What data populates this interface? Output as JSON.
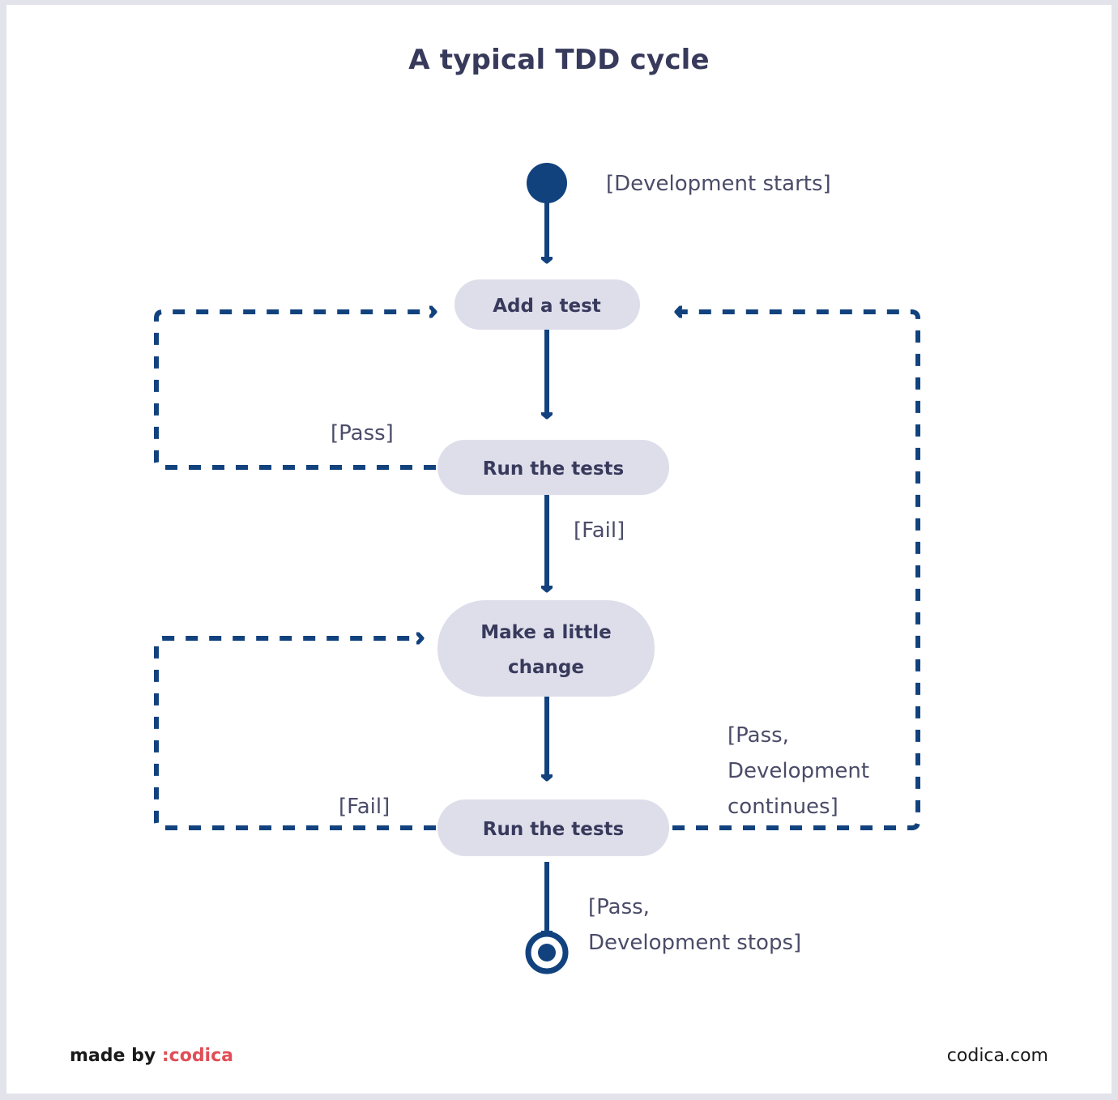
{
  "page": {
    "title": "A typical TDD cycle",
    "background_color": "#ffffff",
    "border_color": "#e3e3ec"
  },
  "colors": {
    "title_text": "#383a5c",
    "node_fill": "#dedeeb",
    "node_text": "#383a5c",
    "arrow": "#12427e",
    "guard_text": "#4a4c68",
    "brand_accent": "#e14d56"
  },
  "diagram": {
    "type": "uml-activity-diagram",
    "nodes": [
      {
        "id": "start",
        "kind": "initial-node",
        "label": ""
      },
      {
        "id": "add-a-test",
        "kind": "action",
        "label": "Add a test"
      },
      {
        "id": "run-the-tests-1",
        "kind": "action",
        "label": "Run the tests"
      },
      {
        "id": "make-a-little-change",
        "kind": "action",
        "label_line1": "Make a little",
        "label_line2": "change"
      },
      {
        "id": "run-the-tests-2",
        "kind": "action",
        "label": "Run the tests"
      },
      {
        "id": "end",
        "kind": "final-node",
        "label": ""
      }
    ],
    "guards": {
      "development_starts": "[Development starts]",
      "pass": "[Pass]",
      "fail_1": "[Fail]",
      "fail_2": "[Fail]",
      "pass_development_continues_line1": "[Pass,",
      "pass_development_continues_line2": "Development",
      "pass_development_continues_line3": "continues]",
      "pass_development_stops_line1": "[Pass,",
      "pass_development_stops_line2": "Development stops]"
    }
  },
  "footer": {
    "made_by": "made by",
    "brand": ":codica",
    "site": "codica.com"
  }
}
